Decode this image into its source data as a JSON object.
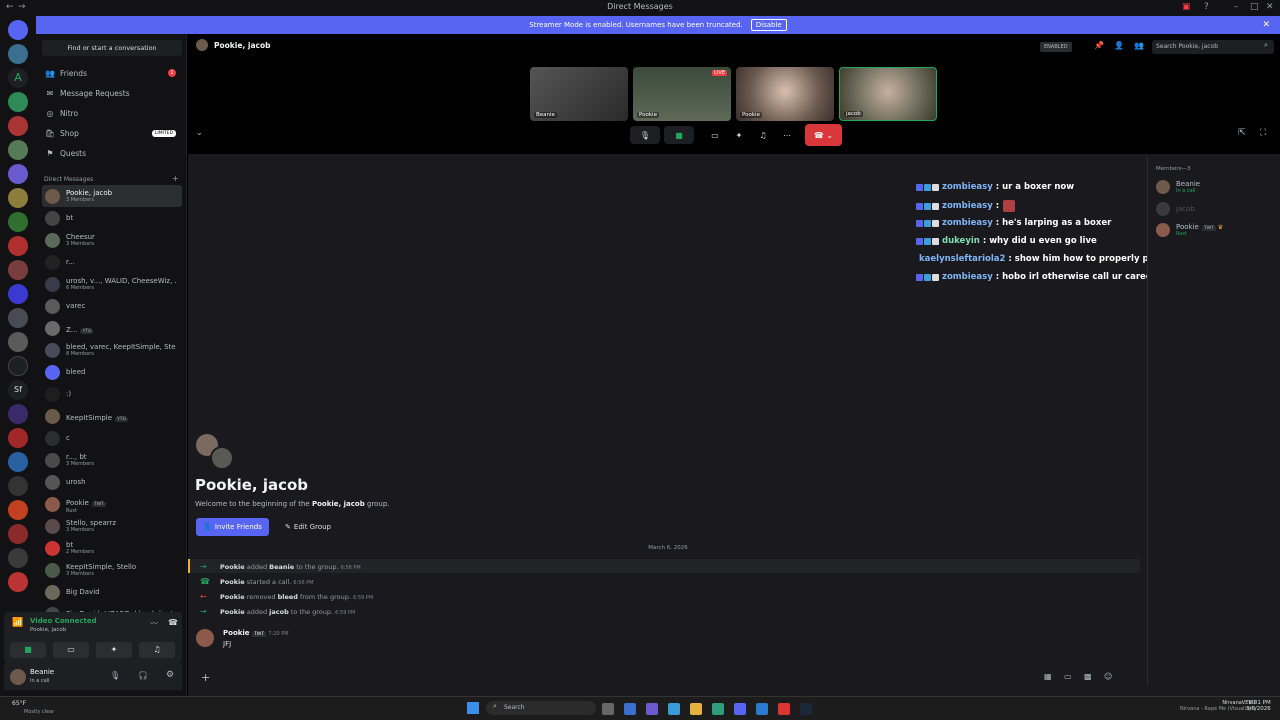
{
  "window": {
    "title": "Direct Messages"
  },
  "banner": {
    "text": "Streamer Mode is enabled. Usernames have been truncated.",
    "disable_label": "Disable"
  },
  "sidebar": {
    "find_placeholder": "Find or start a conversation",
    "nav": [
      {
        "label": "Friends",
        "badge": "1"
      },
      {
        "label": "Message Requests"
      },
      {
        "label": "Nitro"
      },
      {
        "label": "Shop",
        "tag": "LIMITED"
      },
      {
        "label": "Quests"
      }
    ],
    "dm_header": "Direct Messages",
    "dms": [
      {
        "name": "Pookie, jacob",
        "sub": "3 Members"
      },
      {
        "name": "bt",
        "sub": ""
      },
      {
        "name": "Cheesur",
        "sub": "3 Members"
      },
      {
        "name": "r...",
        "sub": ""
      },
      {
        "name": "urosh, v..., WALID, CheeseWiz, ...",
        "sub": "6 Members"
      },
      {
        "name": "varec",
        "sub": ""
      },
      {
        "name": "Z...",
        "sub": "",
        "tag": "YTG"
      },
      {
        "name": "bleed, varec, KeepItSimple, Ste...",
        "sub": "8 Members"
      },
      {
        "name": "bleed",
        "sub": ""
      },
      {
        "name": ":)",
        "sub": ""
      },
      {
        "name": "KeepItSimple",
        "sub": "",
        "tag": "YTG"
      },
      {
        "name": "c",
        "sub": ""
      },
      {
        "name": "r..., bt",
        "sub": "3 Members"
      },
      {
        "name": "urosh",
        "sub": ""
      },
      {
        "name": "Pookie",
        "sub": "Rust",
        "tag": "TWT"
      },
      {
        "name": "Stello, spearrz",
        "sub": "3 Members"
      },
      {
        "name": "bt",
        "sub": "2 Members"
      },
      {
        "name": "KeepItSimple, Stello",
        "sub": "3 Members"
      },
      {
        "name": "Big David",
        "sub": ""
      },
      {
        "name": "Big David, LIZARD, bleed, jinxt...",
        "sub": ""
      }
    ],
    "voice": {
      "status": "Video Connected",
      "channel": "Pookie, jacob"
    },
    "user": {
      "name": "Beanie",
      "status": "In a call"
    }
  },
  "header": {
    "title": "Pookie, jacob",
    "streamer_badge": "ENABLED",
    "search_placeholder": "Search Pookie, jacob"
  },
  "call": {
    "tiles": [
      {
        "label": "Beanie",
        "live": false
      },
      {
        "label": "Pookie",
        "live": true,
        "live_label": "LIVE"
      },
      {
        "label": "Pookie",
        "live": false
      },
      {
        "label": "jacob",
        "live": false
      }
    ]
  },
  "chat_overlay": [
    {
      "user": "zombieasy",
      "text": ": ur a boxer now"
    },
    {
      "user": "zombieasy",
      "text": ":"
    },
    {
      "user": "zombieasy",
      "text": ": he's larping as a boxer"
    },
    {
      "user": "dukeyin",
      "text": ": why did u even go live"
    },
    {
      "user": "kaelynsleftariola2",
      "text": ": show him how to properly punch a fridge"
    },
    {
      "user": "zombieasy",
      "text": ": hobo irl otherwise call ur career a end"
    }
  ],
  "members": {
    "header": "Members—3",
    "list": [
      {
        "name": "Beanie",
        "sub": "In a call"
      },
      {
        "name": "jacob",
        "sub": ""
      },
      {
        "name": "Pookie",
        "sub": "Rust",
        "tag": "TWT"
      }
    ]
  },
  "intro": {
    "title": "Pookie, jacob",
    "subtitle_prefix": "Welcome to the beginning of the ",
    "subtitle_name": "Pookie, jacob",
    "subtitle_suffix": " group.",
    "invite_label": "Invite Friends",
    "edit_label": "Edit Group"
  },
  "date_separator": "March 6, 2026",
  "system_messages": [
    {
      "actor": "Pookie",
      "action": " added ",
      "target": "Beanie",
      "rest": " to the group.",
      "time": "6:56 PM",
      "kind": "add"
    },
    {
      "actor": "Pookie",
      "action": " started a call.",
      "target": "",
      "rest": "",
      "time": "6:56 PM",
      "kind": "call"
    },
    {
      "actor": "Pookie",
      "action": " removed ",
      "target": "bleed",
      "rest": " from the group.",
      "time": "6:59 PM",
      "kind": "remove"
    },
    {
      "actor": "Pookie",
      "action": " added ",
      "target": "jacob",
      "rest": " to the group.",
      "time": "6:59 PM",
      "kind": "add"
    }
  ],
  "message": {
    "author": "Pookie",
    "tag": "TWT",
    "time": "7:20 PM",
    "text": "JFJ"
  },
  "taskbar": {
    "weather": "65°F",
    "weather_sub": "Mostly clear",
    "search_label": "Search",
    "now_playing": "NirvanaVEVO",
    "now_playing_sub": "Nirvana - Rape Me (Visualizer)",
    "time": "8:01 PM",
    "date": "3/6/2026"
  }
}
